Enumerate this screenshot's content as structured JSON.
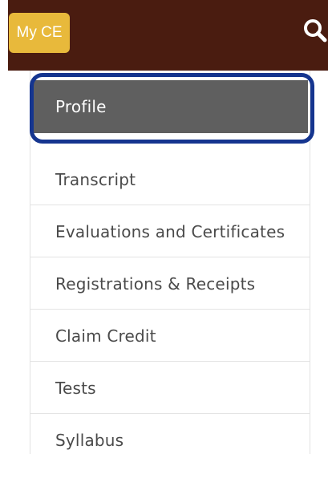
{
  "header": {
    "my_ce_label": "My CE",
    "brand_color": "#4a1c10",
    "accent_color": "#e8b93b",
    "search_icon": "search-icon"
  },
  "menu": {
    "items": [
      {
        "label": "Profile",
        "selected": true
      },
      {
        "label": "Transcript"
      },
      {
        "label": "Evaluations and Certificates"
      },
      {
        "label": "Registrations & Receipts"
      },
      {
        "label": "Claim Credit"
      },
      {
        "label": "Tests"
      },
      {
        "label": "Syllabus"
      }
    ],
    "selected_bg": "#5f5f5f",
    "highlight_color": "#15358f"
  }
}
